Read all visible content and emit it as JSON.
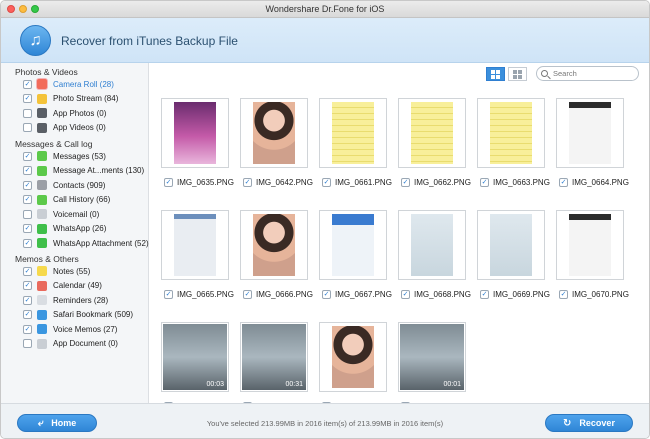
{
  "window": {
    "title": "Wondershare Dr.Fone for iOS"
  },
  "header": {
    "title": "Recover from iTunes Backup File"
  },
  "colors": {
    "accent": "#2f7fd1",
    "header_bg": "#dcecfa",
    "button": "#3b8fdc"
  },
  "sidebar": {
    "categories": [
      {
        "label": "Photos & Videos",
        "items": [
          {
            "label": "Camera Roll (28)",
            "checked": true,
            "selected": true,
            "icon": "camera-roll-icon",
            "icon_color": "#f26b5b"
          },
          {
            "label": "Photo Stream (84)",
            "checked": true,
            "selected": false,
            "icon": "photo-stream-icon",
            "icon_color": "#f4c33a"
          },
          {
            "label": "App Photos (0)",
            "checked": false,
            "selected": false,
            "icon": "app-photos-icon",
            "icon_color": "#5a5f66"
          },
          {
            "label": "App Videos (0)",
            "checked": false,
            "selected": false,
            "icon": "app-videos-icon",
            "icon_color": "#5a5f66"
          }
        ]
      },
      {
        "label": "Messages & Call log",
        "items": [
          {
            "label": "Messages (53)",
            "checked": true,
            "selected": false,
            "icon": "messages-icon",
            "icon_color": "#5cc94a"
          },
          {
            "label": "Message At...ments (130)",
            "checked": true,
            "selected": false,
            "icon": "message-attachments-icon",
            "icon_color": "#5cc94a"
          },
          {
            "label": "Contacts (909)",
            "checked": true,
            "selected": false,
            "icon": "contacts-icon",
            "icon_color": "#9b9fa6"
          },
          {
            "label": "Call History (66)",
            "checked": true,
            "selected": false,
            "icon": "call-history-icon",
            "icon_color": "#5cc94a"
          },
          {
            "label": "Voicemail (0)",
            "checked": false,
            "selected": false,
            "icon": "voicemail-icon",
            "icon_color": "#c9ced4"
          },
          {
            "label": "WhatsApp (26)",
            "checked": true,
            "selected": false,
            "icon": "whatsapp-icon",
            "icon_color": "#3fbf4a"
          },
          {
            "label": "WhatsApp Attachment (52)",
            "checked": true,
            "selected": false,
            "icon": "whatsapp-attachment-icon",
            "icon_color": "#3fbf4a"
          }
        ]
      },
      {
        "label": "Memos & Others",
        "items": [
          {
            "label": "Notes (55)",
            "checked": true,
            "selected": false,
            "icon": "notes-icon",
            "icon_color": "#f6d94c"
          },
          {
            "label": "Calendar (49)",
            "checked": true,
            "selected": false,
            "icon": "calendar-icon",
            "icon_color": "#e96a5d"
          },
          {
            "label": "Reminders (28)",
            "checked": true,
            "selected": false,
            "icon": "reminders-icon",
            "icon_color": "#d9dde2"
          },
          {
            "label": "Safari Bookmark (509)",
            "checked": true,
            "selected": false,
            "icon": "safari-bookmark-icon",
            "icon_color": "#3a96e0"
          },
          {
            "label": "Voice Memos (27)",
            "checked": true,
            "selected": false,
            "icon": "voice-memos-icon",
            "icon_color": "#3a96e0"
          },
          {
            "label": "App Document (0)",
            "checked": false,
            "selected": false,
            "icon": "app-document-icon",
            "icon_color": "#c9ced4"
          }
        ]
      }
    ]
  },
  "toolbar": {
    "search_placeholder": "Search",
    "view_mode": "grid"
  },
  "files": [
    {
      "name": "IMG_0635.PNG",
      "checked": true,
      "thumb": "lockscreen",
      "duration": ""
    },
    {
      "name": "IMG_0642.PNG",
      "checked": true,
      "thumb": "photo-girl",
      "duration": ""
    },
    {
      "name": "IMG_0661.PNG",
      "checked": true,
      "thumb": "notes-yellow",
      "duration": ""
    },
    {
      "name": "IMG_0662.PNG",
      "checked": true,
      "thumb": "notes-yellow",
      "duration": ""
    },
    {
      "name": "IMG_0663.PNG",
      "checked": true,
      "thumb": "notes-yellow",
      "duration": ""
    },
    {
      "name": "IMG_0664.PNG",
      "checked": true,
      "thumb": "mail-screen",
      "duration": ""
    },
    {
      "name": "IMG_0665.PNG",
      "checked": true,
      "thumb": "settings-screen",
      "duration": ""
    },
    {
      "name": "IMG_0666.PNG",
      "checked": true,
      "thumb": "photo-girl",
      "duration": ""
    },
    {
      "name": "IMG_0667.PNG",
      "checked": true,
      "thumb": "app-screen",
      "duration": ""
    },
    {
      "name": "IMG_0668.PNG",
      "checked": true,
      "thumb": "chat-screen",
      "duration": ""
    },
    {
      "name": "IMG_0669.PNG",
      "checked": true,
      "thumb": "chat-screen",
      "duration": ""
    },
    {
      "name": "IMG_0670.PNG",
      "checked": true,
      "thumb": "mail-screen",
      "duration": ""
    },
    {
      "name": "",
      "checked": true,
      "thumb": "video",
      "duration": "00:03"
    },
    {
      "name": "",
      "checked": true,
      "thumb": "video",
      "duration": "00:31"
    },
    {
      "name": "",
      "checked": true,
      "thumb": "photo-girl",
      "duration": ""
    },
    {
      "name": "",
      "checked": true,
      "thumb": "video",
      "duration": "00:01"
    }
  ],
  "footer": {
    "home_label": "Home",
    "recover_label": "Recover",
    "status": "You've selected 213.99MB in 2016 item(s) of 213.99MB in 2016 item(s)"
  }
}
